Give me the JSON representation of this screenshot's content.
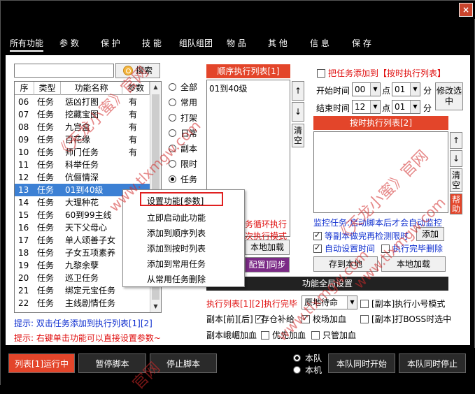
{
  "window": {
    "close_label": "×"
  },
  "tabs": [
    "所有功能",
    "参 数",
    "保 护",
    "技 能",
    "组队组团",
    "物 品",
    "其 他",
    "信 息",
    "保 存"
  ],
  "search": {
    "button_label": "搜索",
    "value": ""
  },
  "list": {
    "headers": [
      "序",
      "类型",
      "功能名称",
      "参数"
    ],
    "rows": [
      [
        "06",
        "任务",
        "惩凶打图",
        "有"
      ],
      [
        "07",
        "任务",
        "挖藏宝图",
        "有"
      ],
      [
        "08",
        "任务",
        "九宫盒",
        "有"
      ],
      [
        "09",
        "任务",
        "百花缘",
        "有"
      ],
      [
        "10",
        "任务",
        "师门任务",
        "有"
      ],
      [
        "11",
        "任务",
        "科举任务",
        ""
      ],
      [
        "12",
        "任务",
        "伉俪情深",
        ""
      ],
      [
        "13",
        "任务",
        "01到40级",
        ""
      ],
      [
        "14",
        "任务",
        "大理种花",
        ""
      ],
      [
        "15",
        "任务",
        "60到99主线",
        ""
      ],
      [
        "16",
        "任务",
        "天下父母心",
        ""
      ],
      [
        "17",
        "任务",
        "单人颂善子女",
        ""
      ],
      [
        "18",
        "任务",
        "子女五项素养",
        ""
      ],
      [
        "19",
        "任务",
        "九黎余孽",
        ""
      ],
      [
        "20",
        "任务",
        "巡卫任务",
        ""
      ],
      [
        "21",
        "任务",
        "绑定元宝任务",
        ""
      ],
      [
        "22",
        "任务",
        "主线剧情任务",
        ""
      ]
    ],
    "selected_index": 7
  },
  "categories": [
    {
      "label": "全部",
      "on": false
    },
    {
      "label": "常用",
      "on": false
    },
    {
      "label": "打架",
      "on": false
    },
    {
      "label": "日常",
      "on": false
    },
    {
      "label": "副本",
      "on": false
    },
    {
      "label": "限时",
      "on": false
    },
    {
      "label": "任务",
      "on": true
    }
  ],
  "seq": {
    "title": "顺序执行列表[1]",
    "items": [
      "01到40级"
    ],
    "up": "↑",
    "down": "↓",
    "clear": "清空",
    "loop_text": "务循环执行",
    "mode_text": "次执行模式",
    "local_load": "本地加载",
    "sync_text": "配置]同步"
  },
  "timed": {
    "add_checkbox": "把任务添加到【按时执行列表】",
    "start_label": "开始时间",
    "start_hour": "00",
    "start_min": "01",
    "end_label": "结束时间",
    "end_hour": "12",
    "end_min": "01",
    "dot": "点",
    "minute": "分",
    "edit_button": "修改选中",
    "title": "按时执行列表[2]",
    "up": "↑",
    "down": "↓",
    "clear": "清空",
    "help": "帮助",
    "monitor_text": "监控任务:启动脚本后才会自动监控",
    "wait_check": "等副本做完再检测限时",
    "add_button": "添加",
    "auto_set": "自动设置时间",
    "delete_done": "执行完毕删除",
    "save_local": "存到本地",
    "load_local": "本地加载"
  },
  "global": {
    "title": "功能全局设置",
    "finish_label": "执行列表[1][2]执行完毕",
    "finish_value": "原地待命",
    "small_mode": "[副本]执行小号模式",
    "dungeon_before_after": "副本[前][后]",
    "warehouse": "存仓补给",
    "school_add": "校场加血",
    "boss_mode": "[副本]打BOSS时选中",
    "mountain_add": "副本峨嵋加血",
    "priority_add": "优先加血",
    "only_add": "只管加血"
  },
  "hints": {
    "hint1": "提示: 双击任务添加到执行列表[1][2]",
    "hint2": "提示: 右键单击功能可以直接设置参数~"
  },
  "context_menu": [
    "设置功能[参数]",
    "立即启动此功能",
    "添加到顺序列表",
    "添加到按时列表",
    "添加到常用任务",
    "从常用任务删除"
  ],
  "bottom": {
    "run_label": "列表[1]运行中",
    "pause": "暂停脚本",
    "stop": "停止脚本",
    "team_radio": "本队",
    "local_radio": "本机",
    "team_start": "本队同时开始",
    "team_stop": "本队同时停止"
  },
  "watermark": [
    "《天龙小蜜》官网",
    "www.tlxmgw.com",
    "官网"
  ]
}
